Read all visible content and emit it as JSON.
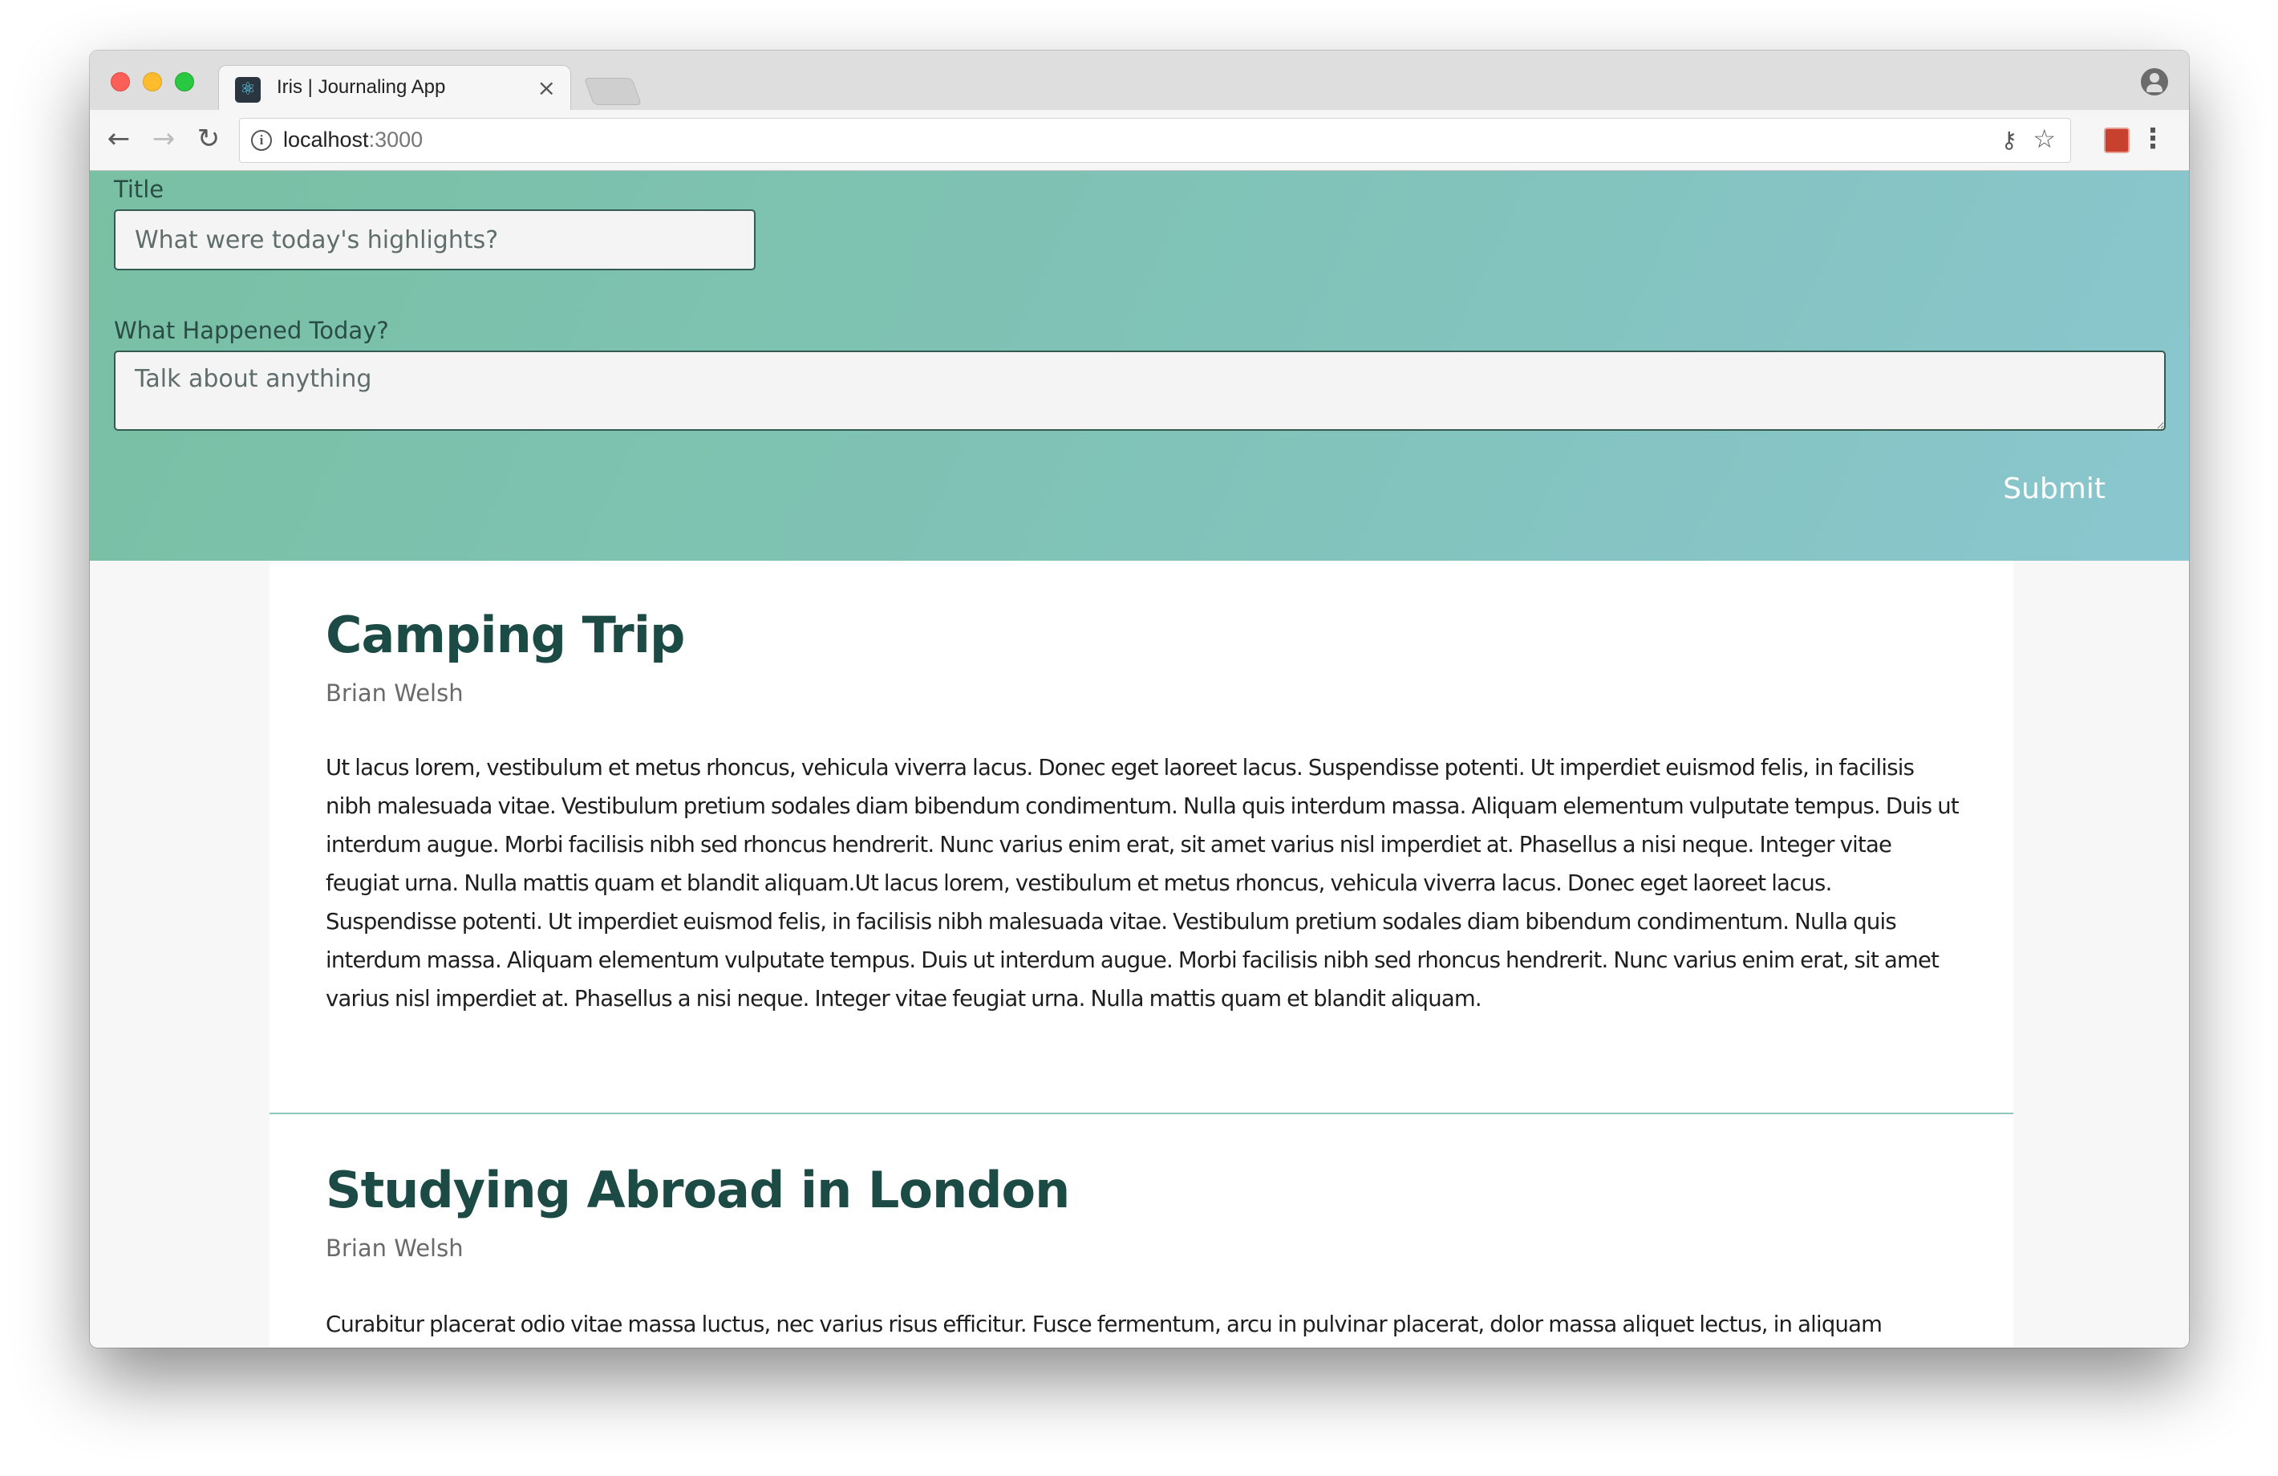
{
  "browser": {
    "tab_title": "Iris | Journaling App",
    "tab_icon": "react-icon",
    "close_glyph": "×",
    "url_host": "localhost",
    "url_port": ":3000"
  },
  "form": {
    "title_label": "Title",
    "title_placeholder": "What were today's highlights?",
    "body_label": "What Happened Today?",
    "body_placeholder": "Talk about anything",
    "submit_label": "Submit"
  },
  "entries": [
    {
      "title": "Camping Trip",
      "author": "Brian Welsh",
      "body": "Ut lacus lorem, vestibulum et metus rhoncus, vehicula viverra lacus. Donec eget laoreet lacus. Suspendisse potenti. Ut imperdiet euismod felis, in facilisis nibh malesuada vitae. Vestibulum pretium sodales diam bibendum condimentum. Nulla quis interdum massa. Aliquam elementum vulputate tempus. Duis ut interdum augue. Morbi facilisis nibh sed rhoncus hendrerit. Nunc varius enim erat, sit amet varius nisl imperdiet at. Phasellus a nisi neque. Integer vitae feugiat urna. Nulla mattis quam et blandit aliquam.Ut lacus lorem, vestibulum et metus rhoncus, vehicula viverra lacus. Donec eget laoreet lacus. Suspendisse potenti. Ut imperdiet euismod felis, in facilisis nibh malesuada vitae. Vestibulum pretium sodales diam bibendum condimentum. Nulla quis interdum massa. Aliquam elementum vulputate tempus. Duis ut interdum augue. Morbi facilisis nibh sed rhoncus hendrerit. Nunc varius enim erat, sit amet varius nisl imperdiet at. Phasellus a nisi neque. Integer vitae feugiat urna. Nulla mattis quam et blandit aliquam."
    },
    {
      "title": "Studying Abroad in London",
      "author": "Brian Welsh",
      "body": "Curabitur placerat odio vitae massa luctus, nec varius risus efficitur. Fusce fermentum, arcu in pulvinar placerat, dolor massa aliquet lectus, in aliquam"
    }
  ],
  "colors": {
    "hero_gradient_start": "#79c0a4",
    "hero_gradient_end": "#8ac6cf",
    "entry_title": "#1c4a44",
    "divider": "#8fc6c4"
  }
}
